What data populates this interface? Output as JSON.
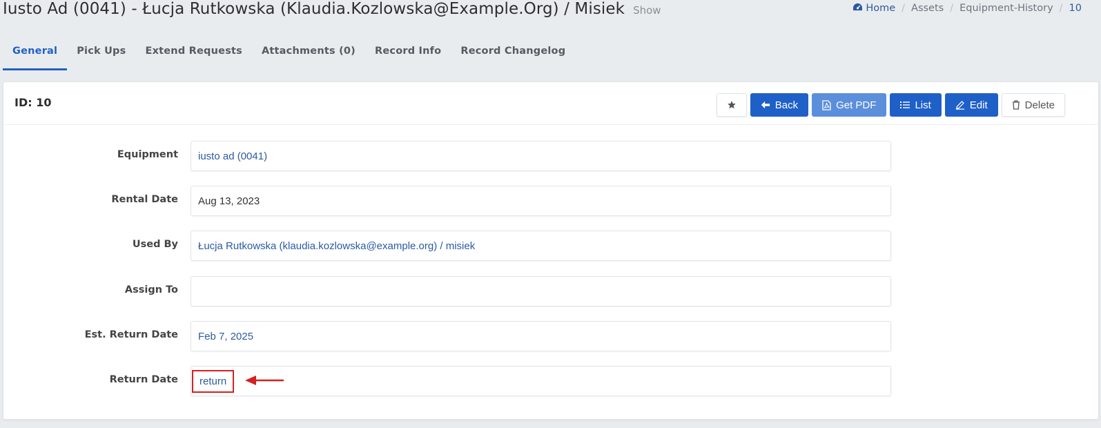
{
  "header": {
    "title": "Iusto Ad (0041) - Łucja Rutkowska (Klaudia.Kozlowska@Example.Org) / Misiek",
    "subtitle": "Show"
  },
  "breadcrumb": {
    "home": "Home",
    "assets": "Assets",
    "section": "Equipment-History",
    "current": "10"
  },
  "tabs": [
    {
      "label": "General",
      "active": true
    },
    {
      "label": "Pick Ups"
    },
    {
      "label": "Extend Requests"
    },
    {
      "label": "Attachments (0)"
    },
    {
      "label": "Record Info"
    },
    {
      "label": "Record Changelog"
    }
  ],
  "card": {
    "id_label": "ID: 10",
    "buttons": {
      "favorite_icon": "star-icon",
      "back": "Back",
      "pdf": "Get PDF",
      "list": "List",
      "edit": "Edit",
      "delete": "Delete"
    }
  },
  "fields": {
    "equipment": {
      "label": "Equipment",
      "value": "iusto ad (0041)"
    },
    "rental_date": {
      "label": "Rental Date",
      "value": "Aug 13, 2023"
    },
    "used_by": {
      "label": "Used By",
      "value": "Łucja Rutkowska (klaudia.kozlowska@example.org) / misiek"
    },
    "assign_to": {
      "label": "Assign To",
      "value": ""
    },
    "est_return_date": {
      "label": "Est. Return Date",
      "value": "Feb 7, 2025"
    },
    "return_date": {
      "label": "Return Date",
      "value": "return"
    }
  },
  "colors": {
    "primary": "#1f60c8",
    "info": "#5b8fdb",
    "link": "#2c5aa0",
    "highlight": "#d32020"
  }
}
